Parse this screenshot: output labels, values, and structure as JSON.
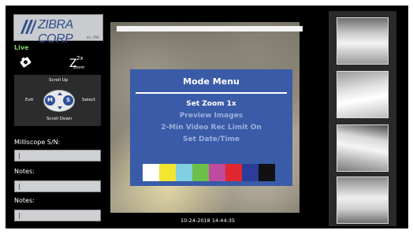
{
  "sidebar": {
    "logo_text": "ZIBRA CORP",
    "logo_subtext": "Inc. PSR",
    "live_label": "Live",
    "zoom_button": {
      "big": "Z",
      "sup": "2x",
      "caption": "Zoom"
    },
    "control_pad": {
      "scroll_up": "Scroll Up",
      "scroll_down": "Scroll Down",
      "exit": "Exit",
      "select": "Select",
      "left_key": "M",
      "right_key": "S"
    },
    "serial_label": "Milliscope S/N:",
    "serial_value": "",
    "notes1_label": "Notes:",
    "notes1_value": "",
    "notes2_label": "Notes:",
    "notes2_value": ""
  },
  "main": {
    "timestamp": "10-24-2018 14:44:35",
    "mode_menu": {
      "title": "Mode Menu",
      "items": [
        {
          "label": "Set Zoom 1x",
          "active": true
        },
        {
          "label": "Preview Images",
          "active": false
        },
        {
          "label": "2-Min Video Rec Limit On",
          "active": false
        },
        {
          "label": "Set Date/Time",
          "active": false
        }
      ],
      "color_bars": [
        "#ffffff",
        "#f4e531",
        "#7fd0e0",
        "#6cc04a",
        "#c04a9e",
        "#e0262e",
        "#2c3c9a",
        "#111111"
      ]
    }
  },
  "colors": {
    "live_green": "#7fd16a",
    "menu_blue": "#3a5ba7"
  },
  "icons": [
    "camera-icon",
    "zoom-icon",
    "joystick-icon"
  ]
}
